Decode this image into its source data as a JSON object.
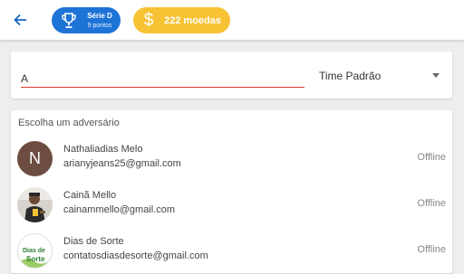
{
  "header": {
    "back_icon": "arrow-left-icon",
    "series": {
      "title": "Série D",
      "points": "9 pontos",
      "icon": "trophy-icon",
      "color": "#1e73d6"
    },
    "coins": {
      "label": "222 moedas",
      "icon_glyph": "$",
      "icon": "dollar-icon",
      "color": "#f7c234"
    }
  },
  "search": {
    "value": "A",
    "underline_color": "#e53935",
    "team_label": "Time Padrão"
  },
  "opponents": {
    "title": "Escolha um adversário",
    "items": [
      {
        "name": "Nathaliadias Melo",
        "email": "arianyjeans25@gmail.com",
        "status": "Offline",
        "avatar_letter": "N",
        "avatar_color": "#6d4c41"
      },
      {
        "name": "Cainã Mello",
        "email": "cainammello@gmail.com",
        "status": "Offline",
        "avatar": "photo"
      },
      {
        "name": "Dias de Sorte",
        "email": "contatosdiasdesorte@gmail.com",
        "status": "Offline",
        "avatar": "logo",
        "avatar_logo_text": "Dias de Sorte"
      }
    ]
  }
}
